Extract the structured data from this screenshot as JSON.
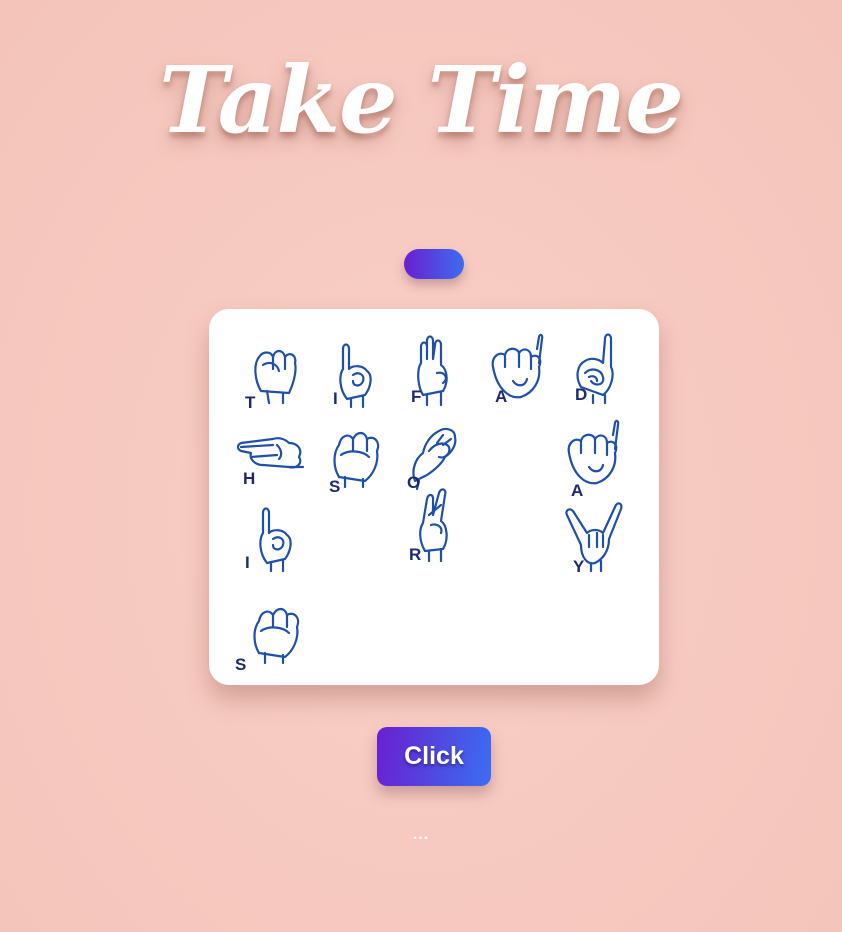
{
  "page": {
    "title": "Take Time",
    "status_text": "..."
  },
  "signs": [
    {
      "letter": "T",
      "hand": "fist-thumb-in"
    },
    {
      "letter": "I",
      "hand": "pinky-up"
    },
    {
      "letter": "F",
      "hand": "three-fingers"
    },
    {
      "letter": "A",
      "hand": "fist-thumb-side"
    },
    {
      "letter": "D",
      "hand": "index-up"
    },
    {
      "letter": "H",
      "hand": "two-fingers-sideways"
    },
    {
      "letter": "S",
      "hand": "fist-thumb-across"
    },
    {
      "letter": "O",
      "hand": "o-shape"
    },
    {
      "letter": "A",
      "hand": "fist-thumb-side"
    },
    {
      "letter": "I",
      "hand": "pinky-up"
    },
    {
      "letter": "R",
      "hand": "crossed-fingers"
    },
    {
      "letter": "Y",
      "hand": "thumb-and-pinky"
    },
    {
      "letter": "S",
      "hand": "fist-thumb-across"
    }
  ],
  "controls": {
    "click_label": "Click"
  },
  "colors": {
    "background": "#f7cbc2",
    "accent_start": "#6a1fd0",
    "accent_end": "#3a6ef2",
    "sign_stroke": "#1f4fa8",
    "sign_letter": "#1e2a6b"
  }
}
